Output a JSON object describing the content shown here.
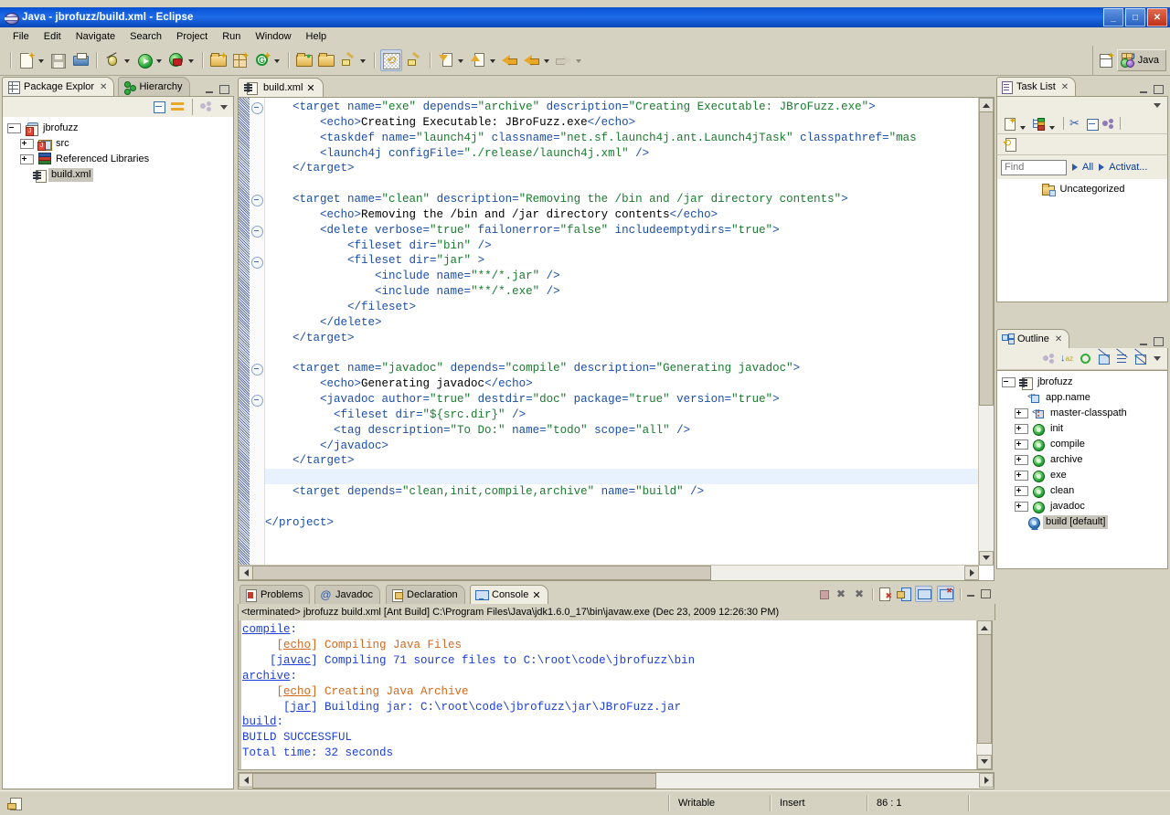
{
  "window": {
    "title": "Java - jbrofuzz/build.xml - Eclipse",
    "icon": "eclipse-icon",
    "buttons": {
      "minimize": "_",
      "maximize": "□",
      "close": "✕"
    }
  },
  "menu": {
    "items": [
      "File",
      "Edit",
      "Navigate",
      "Search",
      "Project",
      "Run",
      "Window",
      "Help"
    ]
  },
  "toolbar": {
    "groups": [
      {
        "items": [
          {
            "name": "new-wizard-button",
            "icon": "new-document-icon",
            "dropdown": true
          },
          {
            "name": "save-button",
            "icon": "save-icon",
            "dropdown": false
          },
          {
            "name": "print-button",
            "icon": "print-icon",
            "dropdown": false
          }
        ]
      },
      {
        "items": [
          {
            "name": "debug-button",
            "icon": "debug-bug-icon",
            "dropdown": true
          },
          {
            "name": "run-button",
            "icon": "run-green-play-icon",
            "dropdown": true
          },
          {
            "name": "external-tools-button",
            "icon": "run-external-tools-icon",
            "dropdown": true
          }
        ]
      },
      {
        "items": [
          {
            "name": "new-java-project-button",
            "icon": "new-java-project-icon",
            "dropdown": false
          },
          {
            "name": "new-package-button",
            "icon": "new-package-icon",
            "dropdown": false
          },
          {
            "name": "new-class-button",
            "icon": "new-class-icon",
            "dropdown": true
          }
        ]
      },
      {
        "items": [
          {
            "name": "open-type-button",
            "icon": "open-type-icon",
            "dropdown": false
          },
          {
            "name": "open-task-button",
            "icon": "open-folder-icon",
            "dropdown": false
          },
          {
            "name": "annotation-button",
            "icon": "pencil-icon",
            "dropdown": true
          }
        ]
      },
      {
        "items": [
          {
            "name": "toggle-mark-occurrences-button",
            "icon": "mark-occurrences-icon",
            "dropdown": false
          },
          {
            "name": "quick-fix-button",
            "icon": "paint-brush-icon",
            "dropdown": false
          }
        ]
      },
      {
        "items": [
          {
            "name": "next-annotation-button",
            "icon": "arrow-down-annotation-icon",
            "dropdown": true
          },
          {
            "name": "previous-annotation-button",
            "icon": "arrow-up-annotation-icon",
            "dropdown": true
          },
          {
            "name": "last-edit-location-button",
            "icon": "last-edit-location-icon",
            "dropdown": false
          },
          {
            "name": "back-button",
            "icon": "back-arrow-icon",
            "dropdown": true
          },
          {
            "name": "forward-button",
            "icon": "forward-arrow-icon",
            "dropdown": true
          }
        ]
      }
    ],
    "perspective": {
      "open_perspective_label": "open-perspective-icon",
      "active": "Java"
    }
  },
  "package_explorer": {
    "tabs": [
      {
        "label": "Package Explor",
        "icon": "package-explorer-icon",
        "active": true,
        "closable": true
      },
      {
        "label": "Hierarchy",
        "icon": "hierarchy-icon",
        "active": false,
        "closable": false
      }
    ],
    "toolbar": [
      "collapse-all-icon",
      "link-with-editor-icon",
      "view-menu-icon",
      "view-chevron-icon"
    ],
    "tree": [
      {
        "label": "jbrofuzz",
        "icon": "java-project-icon",
        "expander": "minus",
        "depth": 0,
        "selected": false
      },
      {
        "label": "src",
        "icon": "source-folder-icon",
        "expander": "plus",
        "depth": 1,
        "selected": false
      },
      {
        "label": "Referenced Libraries",
        "icon": "library-icon",
        "expander": "plus",
        "depth": 1,
        "selected": false
      },
      {
        "label": "build.xml",
        "icon": "ant-buildfile-icon",
        "expander": "none",
        "depth": 1,
        "selected": true
      }
    ]
  },
  "editor": {
    "tab": {
      "label": "build.xml",
      "icon": "ant-buildfile-icon",
      "close": "✕",
      "active": true
    },
    "current_line_index": 24,
    "lines": [
      [
        {
          "t": "tx",
          "s": "    "
        },
        {
          "t": "tg",
          "s": "<target "
        },
        {
          "t": "at",
          "s": "name="
        },
        {
          "t": "vl",
          "s": "\"exe\""
        },
        {
          "t": "at",
          "s": " depends="
        },
        {
          "t": "vl",
          "s": "\"archive\""
        },
        {
          "t": "at",
          "s": " description="
        },
        {
          "t": "vl",
          "s": "\"Creating Executable: JBroFuzz.exe\""
        },
        {
          "t": "tg",
          "s": ">"
        }
      ],
      [
        {
          "t": "tx",
          "s": "        "
        },
        {
          "t": "tg",
          "s": "<echo>"
        },
        {
          "t": "tx",
          "s": "Creating Executable: JBroFuzz.exe"
        },
        {
          "t": "tg",
          "s": "</echo>"
        }
      ],
      [
        {
          "t": "tx",
          "s": "        "
        },
        {
          "t": "tg",
          "s": "<taskdef "
        },
        {
          "t": "at",
          "s": "name="
        },
        {
          "t": "vl",
          "s": "\"launch4j\""
        },
        {
          "t": "at",
          "s": " classname="
        },
        {
          "t": "vl",
          "s": "\"net.sf.launch4j.ant.Launch4jTask\""
        },
        {
          "t": "at",
          "s": " classpathref="
        },
        {
          "t": "vl",
          "s": "\"mas"
        }
      ],
      [
        {
          "t": "tx",
          "s": "        "
        },
        {
          "t": "tg",
          "s": "<launch4j "
        },
        {
          "t": "at",
          "s": "configFile="
        },
        {
          "t": "vl",
          "s": "\"./release/launch4j.xml\""
        },
        {
          "t": "tg",
          "s": " />"
        }
      ],
      [
        {
          "t": "tx",
          "s": "    "
        },
        {
          "t": "tg",
          "s": "</target>"
        }
      ],
      [
        {
          "t": "tx",
          "s": ""
        }
      ],
      [
        {
          "t": "tx",
          "s": "    "
        },
        {
          "t": "tg",
          "s": "<target "
        },
        {
          "t": "at",
          "s": "name="
        },
        {
          "t": "vl",
          "s": "\"clean\""
        },
        {
          "t": "at",
          "s": " description="
        },
        {
          "t": "vl",
          "s": "\"Removing the /bin and /jar directory contents\""
        },
        {
          "t": "tg",
          "s": ">"
        }
      ],
      [
        {
          "t": "tx",
          "s": "        "
        },
        {
          "t": "tg",
          "s": "<echo>"
        },
        {
          "t": "tx",
          "s": "Removing the /bin and /jar directory contents"
        },
        {
          "t": "tg",
          "s": "</echo>"
        }
      ],
      [
        {
          "t": "tx",
          "s": "        "
        },
        {
          "t": "tg",
          "s": "<delete "
        },
        {
          "t": "at",
          "s": "verbose="
        },
        {
          "t": "vl",
          "s": "\"true\""
        },
        {
          "t": "at",
          "s": " failonerror="
        },
        {
          "t": "vl",
          "s": "\"false\""
        },
        {
          "t": "at",
          "s": " includeemptydirs="
        },
        {
          "t": "vl",
          "s": "\"true\""
        },
        {
          "t": "tg",
          "s": ">"
        }
      ],
      [
        {
          "t": "tx",
          "s": "            "
        },
        {
          "t": "tg",
          "s": "<fileset "
        },
        {
          "t": "at",
          "s": "dir="
        },
        {
          "t": "vl",
          "s": "\"bin\""
        },
        {
          "t": "tg",
          "s": " />"
        }
      ],
      [
        {
          "t": "tx",
          "s": "            "
        },
        {
          "t": "tg",
          "s": "<fileset "
        },
        {
          "t": "at",
          "s": "dir="
        },
        {
          "t": "vl",
          "s": "\"jar\""
        },
        {
          "t": "tg",
          "s": " >"
        }
      ],
      [
        {
          "t": "tx",
          "s": "                "
        },
        {
          "t": "tg",
          "s": "<include "
        },
        {
          "t": "at",
          "s": "name="
        },
        {
          "t": "vl",
          "s": "\"**/*.jar\""
        },
        {
          "t": "tg",
          "s": " />"
        }
      ],
      [
        {
          "t": "tx",
          "s": "                "
        },
        {
          "t": "tg",
          "s": "<include "
        },
        {
          "t": "at",
          "s": "name="
        },
        {
          "t": "vl",
          "s": "\"**/*.exe\""
        },
        {
          "t": "tg",
          "s": " />"
        }
      ],
      [
        {
          "t": "tx",
          "s": "            "
        },
        {
          "t": "tg",
          "s": "</fileset>"
        }
      ],
      [
        {
          "t": "tx",
          "s": "        "
        },
        {
          "t": "tg",
          "s": "</delete>"
        }
      ],
      [
        {
          "t": "tx",
          "s": "    "
        },
        {
          "t": "tg",
          "s": "</target>"
        }
      ],
      [
        {
          "t": "tx",
          "s": ""
        }
      ],
      [
        {
          "t": "tx",
          "s": "    "
        },
        {
          "t": "tg",
          "s": "<target "
        },
        {
          "t": "at",
          "s": "name="
        },
        {
          "t": "vl",
          "s": "\"javadoc\""
        },
        {
          "t": "at",
          "s": " depends="
        },
        {
          "t": "vl",
          "s": "\"compile\""
        },
        {
          "t": "at",
          "s": " description="
        },
        {
          "t": "vl",
          "s": "\"Generating javadoc\""
        },
        {
          "t": "tg",
          "s": ">"
        }
      ],
      [
        {
          "t": "tx",
          "s": "        "
        },
        {
          "t": "tg",
          "s": "<echo>"
        },
        {
          "t": "tx",
          "s": "Generating javadoc"
        },
        {
          "t": "tg",
          "s": "</echo>"
        }
      ],
      [
        {
          "t": "tx",
          "s": "        "
        },
        {
          "t": "tg",
          "s": "<javadoc "
        },
        {
          "t": "at",
          "s": "author="
        },
        {
          "t": "vl",
          "s": "\"true\""
        },
        {
          "t": "at",
          "s": " destdir="
        },
        {
          "t": "vl",
          "s": "\"doc\""
        },
        {
          "t": "at",
          "s": " package="
        },
        {
          "t": "vl",
          "s": "\"true\""
        },
        {
          "t": "at",
          "s": " version="
        },
        {
          "t": "vl",
          "s": "\"true\""
        },
        {
          "t": "tg",
          "s": ">"
        }
      ],
      [
        {
          "t": "tx",
          "s": "          "
        },
        {
          "t": "tg",
          "s": "<fileset "
        },
        {
          "t": "at",
          "s": "dir="
        },
        {
          "t": "vl",
          "s": "\"${src.dir}\""
        },
        {
          "t": "tg",
          "s": " />"
        }
      ],
      [
        {
          "t": "tx",
          "s": "          "
        },
        {
          "t": "tg",
          "s": "<tag "
        },
        {
          "t": "at",
          "s": "description="
        },
        {
          "t": "vl",
          "s": "\"To Do:\""
        },
        {
          "t": "at",
          "s": " name="
        },
        {
          "t": "vl",
          "s": "\"todo\""
        },
        {
          "t": "at",
          "s": " scope="
        },
        {
          "t": "vl",
          "s": "\"all\""
        },
        {
          "t": "tg",
          "s": " />"
        }
      ],
      [
        {
          "t": "tx",
          "s": "        "
        },
        {
          "t": "tg",
          "s": "</javadoc>"
        }
      ],
      [
        {
          "t": "tx",
          "s": "    "
        },
        {
          "t": "tg",
          "s": "</target>"
        }
      ],
      [
        {
          "t": "tx",
          "s": ""
        }
      ],
      [
        {
          "t": "tx",
          "s": "    "
        },
        {
          "t": "tg",
          "s": "<target "
        },
        {
          "t": "at",
          "s": "depends="
        },
        {
          "t": "vl",
          "s": "\"clean,init,compile,archive\""
        },
        {
          "t": "at",
          "s": " name="
        },
        {
          "t": "vl",
          "s": "\"build\""
        },
        {
          "t": "tg",
          "s": " />"
        }
      ],
      [
        {
          "t": "tx",
          "s": ""
        }
      ],
      [
        {
          "t": "tg",
          "s": "</project>"
        }
      ]
    ],
    "fold_marker_lines": [
      0,
      6,
      8,
      10,
      17,
      19
    ]
  },
  "task_list": {
    "tab": {
      "label": "Task List",
      "icon": "task-list-icon",
      "close": "✕"
    },
    "toolbar": [
      "new-task-icon",
      "categorize-icon",
      "synchronize-icon",
      "collapse-all-icon",
      "filter-icon",
      "restore-icon"
    ],
    "find": {
      "placeholder": "Find",
      "value": ""
    },
    "links": [
      "All",
      "Activat..."
    ],
    "items": [
      {
        "label": "Uncategorized",
        "icon": "category-folder-icon"
      }
    ]
  },
  "outline": {
    "tab": {
      "label": "Outline",
      "icon": "outline-icon",
      "close": "✕"
    },
    "toolbar": [
      "filter-icon",
      "sort-alpha-icon",
      "hide-icon",
      "hide-fields-icon",
      "hide-static-icon",
      "hide-nonpublic-icon",
      "view-chevron-icon"
    ],
    "tree": [
      {
        "label": "jbrofuzz",
        "icon": "ant-buildfile-icon",
        "expander": "minus",
        "depth": 0,
        "selected": false
      },
      {
        "label": "app.name",
        "icon": "ant-property-icon",
        "expander": "none",
        "depth": 1,
        "selected": false
      },
      {
        "label": "master-classpath",
        "icon": "ant-classpath-icon",
        "expander": "plus",
        "depth": 1,
        "selected": false
      },
      {
        "label": "init",
        "icon": "ant-target-icon",
        "expander": "plus",
        "depth": 1,
        "selected": false
      },
      {
        "label": "compile",
        "icon": "ant-target-icon",
        "expander": "plus",
        "depth": 1,
        "selected": false
      },
      {
        "label": "archive",
        "icon": "ant-target-icon",
        "expander": "plus",
        "depth": 1,
        "selected": false
      },
      {
        "label": "exe",
        "icon": "ant-target-icon",
        "expander": "plus",
        "depth": 1,
        "selected": false
      },
      {
        "label": "clean",
        "icon": "ant-target-icon",
        "expander": "plus",
        "depth": 1,
        "selected": false
      },
      {
        "label": "javadoc",
        "icon": "ant-target-icon",
        "expander": "plus",
        "depth": 1,
        "selected": false
      },
      {
        "label": "build [default]",
        "icon": "ant-default-target-icon",
        "expander": "none",
        "depth": 1,
        "selected": true
      }
    ]
  },
  "bottom_panel": {
    "tabs": [
      {
        "label": "Problems",
        "icon": "problems-icon",
        "active": false,
        "closable": false
      },
      {
        "label": "Javadoc",
        "icon": "javadoc-at-icon",
        "active": false,
        "closable": false
      },
      {
        "label": "Declaration",
        "icon": "declaration-icon",
        "active": false,
        "closable": false
      },
      {
        "label": "Console",
        "icon": "console-icon",
        "active": true,
        "closable": true
      }
    ],
    "toolbar": [
      "terminate-icon",
      "remove-launch-icon",
      "remove-all-launches-icon",
      "clear-console-icon",
      "scroll-lock-icon",
      "pin-console-icon",
      "display-selected-console-icon",
      "open-console-icon",
      "minimize-icon",
      "maximize-icon"
    ],
    "console_header": "<terminated> jbrofuzz build.xml [Ant Build] C:\\Program Files\\Java\\jdk1.6.0_17\\bin\\javaw.exe (Dec 23, 2009 12:26:30 PM)",
    "console_lines": [
      [
        {
          "t": "ln",
          "s": "compile"
        },
        {
          "t": "bl",
          "s": ":"
        }
      ],
      [
        {
          "t": "or",
          "s": "     ["
        },
        {
          "t": "orU",
          "s": "echo"
        },
        {
          "t": "or",
          "s": "] Compiling Java Files"
        }
      ],
      [
        {
          "t": "bl",
          "s": "    ["
        },
        {
          "t": "blU",
          "s": "javac"
        },
        {
          "t": "bl",
          "s": "] Compiling 71 source files to C:\\root\\code\\jbrofuzz\\bin"
        }
      ],
      [
        {
          "t": "ln",
          "s": "archive"
        },
        {
          "t": "bl",
          "s": ":"
        }
      ],
      [
        {
          "t": "or",
          "s": "     ["
        },
        {
          "t": "orU",
          "s": "echo"
        },
        {
          "t": "or",
          "s": "] Creating Java Archive"
        }
      ],
      [
        {
          "t": "bl",
          "s": "      ["
        },
        {
          "t": "blU",
          "s": "jar"
        },
        {
          "t": "bl",
          "s": "] Building jar: C:\\root\\code\\jbrofuzz\\jar\\JBroFuzz.jar"
        }
      ],
      [
        {
          "t": "ln",
          "s": "build"
        },
        {
          "t": "bl",
          "s": ":"
        }
      ],
      [
        {
          "t": "bl",
          "s": "BUILD SUCCESSFUL"
        }
      ],
      [
        {
          "t": "bl",
          "s": "Total time: 32 seconds"
        }
      ]
    ]
  },
  "status_bar": {
    "icon": "smart-insert-icon",
    "cells": [
      "Writable",
      "Insert",
      "86 : 1"
    ]
  },
  "colors": {
    "titlebar_blue": "#1f6ce8",
    "chrome": "#d6d2c2",
    "tab_active": "#efece2",
    "xml_tag": "#1b4ea8",
    "xml_value": "#1a7a2e",
    "console_echo": "#d2691e",
    "console_task": "#1b3fd8",
    "selection": "#c8c5ba",
    "current_line": "#e8f2fe"
  }
}
